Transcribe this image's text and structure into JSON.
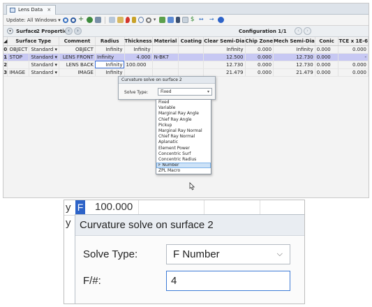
{
  "tab": {
    "label": "Lens Data",
    "close": "×"
  },
  "toolbar": {
    "update_label": "Update: All Windows ▾"
  },
  "props": {
    "surface_label": "Surface",
    "properties_label": "2 Properties",
    "prev": "‹",
    "next": "›",
    "configuration_label": "Configuration 1/1"
  },
  "table": {
    "columns": [
      "Surface Type",
      "Comment",
      "Radius",
      "Thickness",
      "Material",
      "Coating",
      "Clear Semi-Dia",
      "Chip Zone",
      "Mech Semi-Dia",
      "Conic",
      "TCE x 1E-6"
    ],
    "rows": [
      {
        "num": "0",
        "name": "OBJECT",
        "type": "Standard ▾",
        "comment": "OBJECT",
        "radius": "Infinity",
        "thickness": "Infinity",
        "material": "",
        "coating": "",
        "clear": "Infinity",
        "chip": "0.000",
        "mech": "Infinity",
        "conic": "0.000",
        "tce": "0.000"
      },
      {
        "num": "1",
        "name": "STOP",
        "type": "Standard ▾",
        "comment": "LENS FRONT",
        "radius": "Infinity",
        "thickness": "4.000",
        "material": "N-BK7",
        "coating": "",
        "clear": "12.500",
        "chip": "0.000",
        "mech": "12.730",
        "conic": "0.000",
        "tce": "-"
      },
      {
        "num": "2",
        "name": "",
        "type": "Standard ▾",
        "comment": "LENS BACK",
        "radius": "Infinity",
        "thickness": "100.000",
        "material": "",
        "coating": "",
        "clear": "12.730",
        "chip": "0.000",
        "mech": "12.730",
        "conic": "0.000",
        "tce": "0.000"
      },
      {
        "num": "3",
        "name": "IMAGE",
        "type": "Standard ▾",
        "comment": "IMAGE",
        "radius": "Infinity",
        "thickness": "",
        "material": "",
        "coating": "",
        "clear": "21.479",
        "chip": "0.000",
        "mech": "21.479",
        "conic": "0.000",
        "tce": "0.000"
      }
    ]
  },
  "solve_dialog": {
    "title": "Curvature solve on surface 2",
    "type_label": "Solve Type:",
    "type_value": "Fixed",
    "options": [
      "Fixed",
      "Variable",
      "Marginal Ray Angle",
      "Chief Ray Angle",
      "Pickup",
      "Marginal Ray Normal",
      "Chief Ray Normal",
      "Aplanatic",
      "Element Power",
      "Concentric Surf",
      "Concentric Radius",
      "F Number",
      "ZPL Macro"
    ],
    "highlighted": "F Number"
  },
  "zoom": {
    "bg_letter_1": "y",
    "bg_cell_f": "F",
    "bg_value": "100.000",
    "bg_letter_2": "y",
    "dialog_title": "Curvature solve on surface 2",
    "solve_type_label": "Solve Type:",
    "solve_type_value": "F Number",
    "fnum_label": "F/#:",
    "fnum_value": "4"
  }
}
